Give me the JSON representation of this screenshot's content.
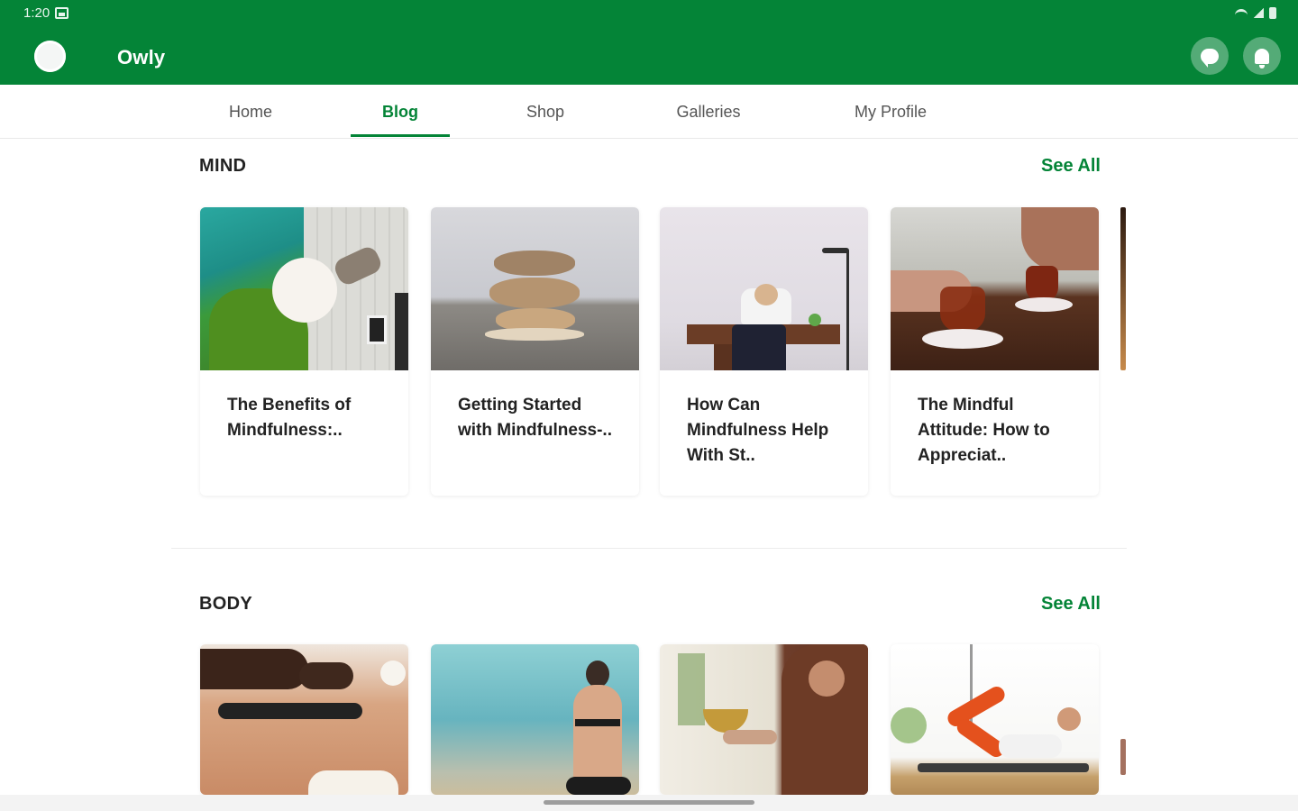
{
  "status_bar": {
    "time": "1:20"
  },
  "app_bar": {
    "title": "Owly"
  },
  "tabs": [
    {
      "label": "Home",
      "active": false
    },
    {
      "label": "Blog",
      "active": true
    },
    {
      "label": "Shop",
      "active": false
    },
    {
      "label": "Galleries",
      "active": false
    },
    {
      "label": "My Profile",
      "active": false
    }
  ],
  "sections": [
    {
      "title": "MIND",
      "see_all": "See All",
      "posts": [
        {
          "title": "The Benefits of Mindfulness:.."
        },
        {
          "title": "Getting Started with Mindfulness-.."
        },
        {
          "title": "How Can Mindfulness Help With St.."
        },
        {
          "title": "The Mindful Attitude: How to Appreciat.."
        }
      ]
    },
    {
      "title": "BODY",
      "see_all": "See All",
      "posts": [
        {
          "title": ""
        },
        {
          "title": ""
        },
        {
          "title": ""
        },
        {
          "title": ""
        }
      ]
    }
  ],
  "colors": {
    "brand_green": "#048437",
    "text_dark": "#222222",
    "tab_inactive": "#555555"
  },
  "icons": {
    "chat": "chat-bubble-icon",
    "notifications": "bell-icon"
  }
}
